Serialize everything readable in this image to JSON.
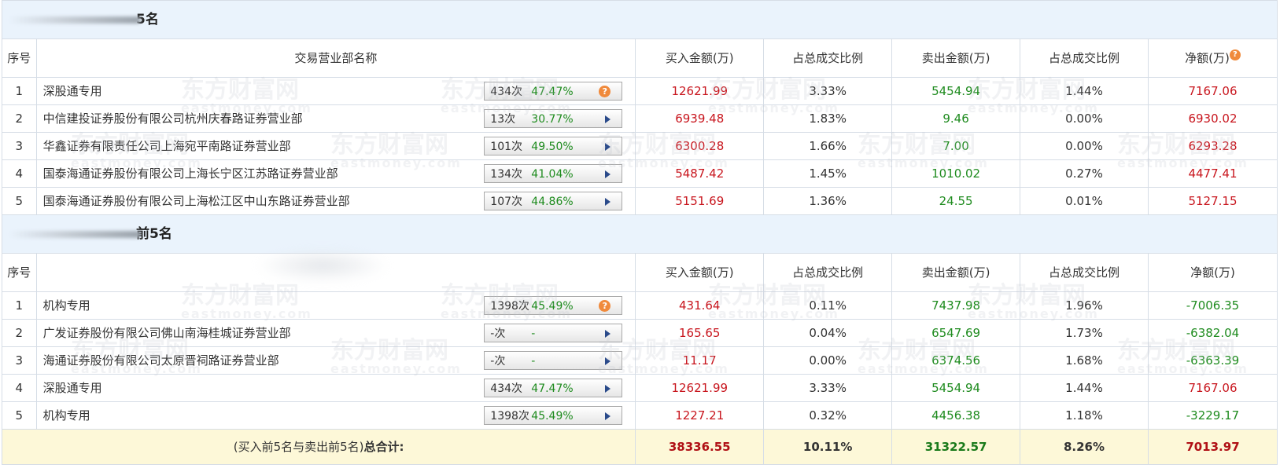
{
  "buy_section": {
    "title": "5名",
    "headers": [
      "序号",
      "交易营业部名称",
      "买入金额(万)",
      "占总成交比例",
      "卖出金额(万)",
      "占总成交比例",
      "净额(万)"
    ],
    "net_help_icon": "question-icon",
    "rows": [
      {
        "idx": "1",
        "name": "深股通专用",
        "count": "434次",
        "pct": "47.47%",
        "icon": "question-icon",
        "buy": "12621.99",
        "buy_ratio": "3.33%",
        "sell": "5454.94",
        "sell_ratio": "1.44%",
        "net": "7167.06"
      },
      {
        "idx": "2",
        "name": "中信建投证券股份有限公司杭州庆春路证券营业部",
        "count": "13次",
        "pct": "30.77%",
        "icon": "arrow-right-icon",
        "buy": "6939.48",
        "buy_ratio": "1.83%",
        "sell": "9.46",
        "sell_ratio": "0.00%",
        "net": "6930.02"
      },
      {
        "idx": "3",
        "name": "华鑫证券有限责任公司上海宛平南路证券营业部",
        "count": "101次",
        "pct": "49.50%",
        "icon": "arrow-right-icon",
        "buy": "6300.28",
        "buy_ratio": "1.66%",
        "sell": "7.00",
        "sell_ratio": "0.00%",
        "net": "6293.28"
      },
      {
        "idx": "4",
        "name": "国泰海通证券股份有限公司上海长宁区江苏路证券营业部",
        "count": "134次",
        "pct": "41.04%",
        "icon": "arrow-right-icon",
        "buy": "5487.42",
        "buy_ratio": "1.45%",
        "sell": "1010.02",
        "sell_ratio": "0.27%",
        "net": "4477.41"
      },
      {
        "idx": "5",
        "name": "国泰海通证券股份有限公司上海松江区中山东路证券营业部",
        "count": "107次",
        "pct": "44.86%",
        "icon": "arrow-right-icon",
        "buy": "5151.69",
        "buy_ratio": "1.36%",
        "sell": "24.55",
        "sell_ratio": "0.01%",
        "net": "5127.15"
      }
    ]
  },
  "sell_section": {
    "title": "前5名",
    "headers": [
      "序号",
      "",
      "买入金额(万)",
      "占总成交比例",
      "卖出金额(万)",
      "占总成交比例",
      "净额(万)"
    ],
    "rows": [
      {
        "idx": "1",
        "name": "机构专用",
        "count": "1398次",
        "pct": "45.49%",
        "icon": "question-icon",
        "buy": "431.64",
        "buy_ratio": "0.11%",
        "sell": "7437.98",
        "sell_ratio": "1.96%",
        "net": "-7006.35"
      },
      {
        "idx": "2",
        "name": "广发证券股份有限公司佛山南海桂城证券营业部",
        "count": "-次",
        "pct": "-",
        "icon": "arrow-right-icon",
        "buy": "165.65",
        "buy_ratio": "0.04%",
        "sell": "6547.69",
        "sell_ratio": "1.73%",
        "net": "-6382.04"
      },
      {
        "idx": "3",
        "name": "海通证券股份有限公司太原晋祠路证券营业部",
        "count": "-次",
        "pct": "-",
        "icon": "arrow-right-icon",
        "buy": "11.17",
        "buy_ratio": "0.00%",
        "sell": "6374.56",
        "sell_ratio": "1.68%",
        "net": "-6363.39"
      },
      {
        "idx": "4",
        "name": "深股通专用",
        "count": "434次",
        "pct": "47.47%",
        "icon": "arrow-right-icon",
        "buy": "12621.99",
        "buy_ratio": "3.33%",
        "sell": "5454.94",
        "sell_ratio": "1.44%",
        "net": "7167.06"
      },
      {
        "idx": "5",
        "name": "机构专用",
        "count": "1398次",
        "pct": "45.49%",
        "icon": "arrow-right-icon",
        "buy": "1227.21",
        "buy_ratio": "0.32%",
        "sell": "4456.38",
        "sell_ratio": "1.18%",
        "net": "-3229.17"
      }
    ]
  },
  "total": {
    "label_prefix": "(买入前5名与卖出前5名)",
    "label_bold": "总合计:",
    "buy": "38336.55",
    "buy_ratio": "10.11%",
    "sell": "31322.57",
    "sell_ratio": "8.26%",
    "net": "7013.97"
  },
  "watermark": {
    "brand": "东方财富网",
    "domain": "eastmoney.com"
  },
  "colors": {
    "positive": "#c8151d",
    "negative": "#1e8b1e",
    "section_bg": "#eaf3fc",
    "total_bg": "#fdf8d8",
    "help_icon": "#f08a3c"
  }
}
